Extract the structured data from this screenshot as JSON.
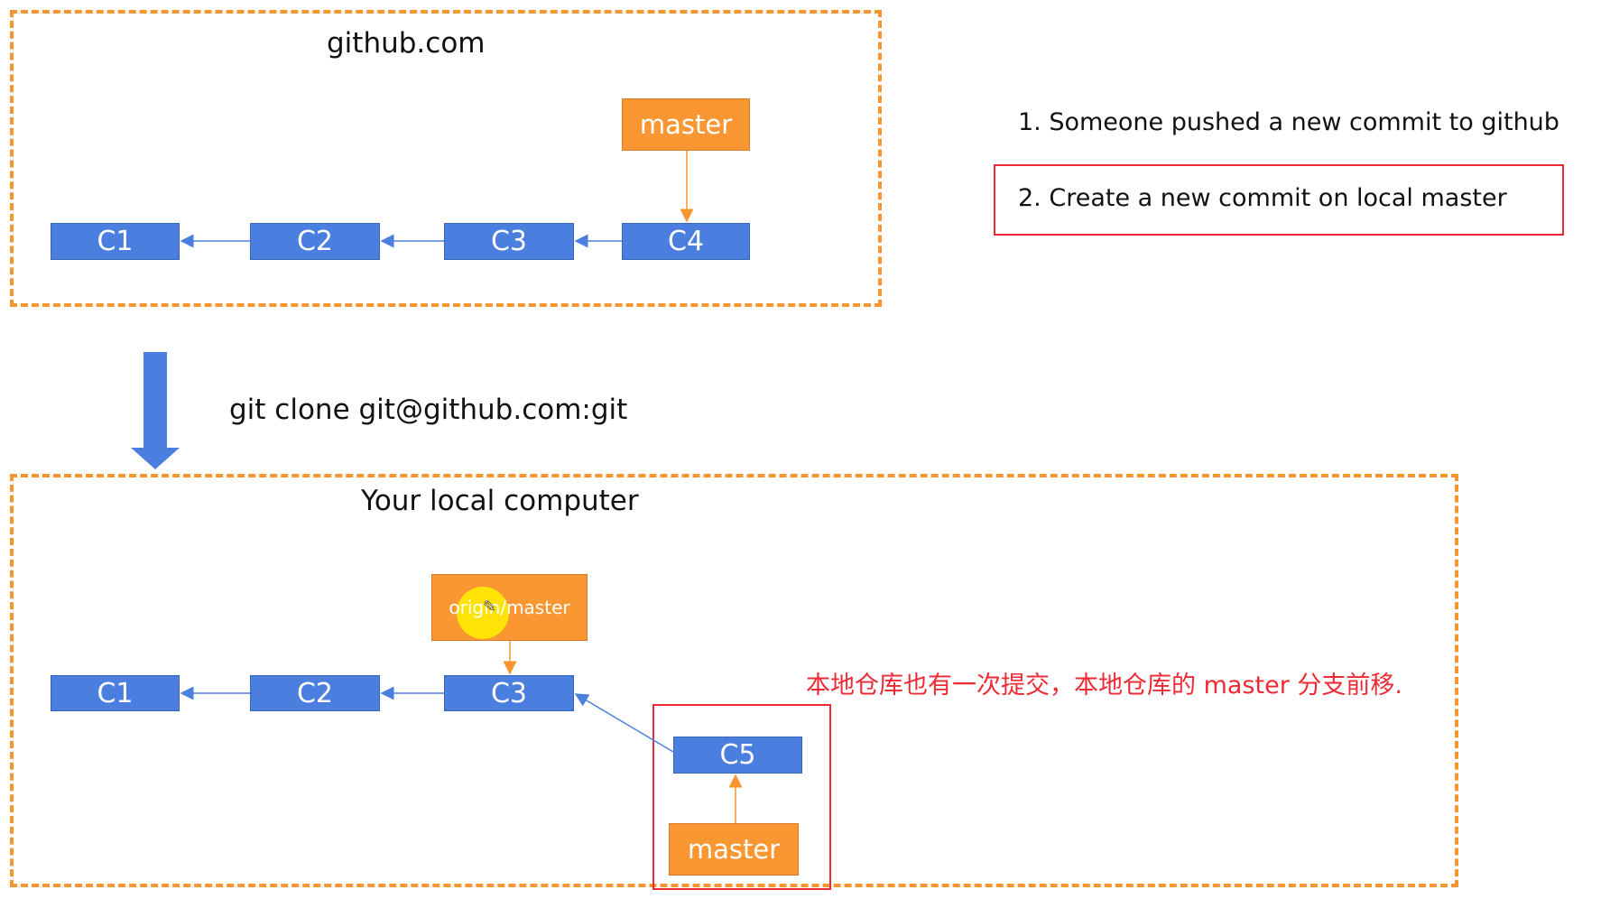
{
  "remote": {
    "title": "github.com",
    "branch_label": "master",
    "commits": [
      "C1",
      "C2",
      "C3",
      "C4"
    ]
  },
  "notes": {
    "step1": "1. Someone pushed a new commit to github",
    "step2": "2.  Create a new commit on local master"
  },
  "clone": {
    "command": "git clone git@github.com:git"
  },
  "local": {
    "title": "Your local computer",
    "remote_branch_label": "origin/master",
    "commits": [
      "C1",
      "C2",
      "C3"
    ],
    "new_commit": "C5",
    "branch_label": "master",
    "annotation": "本地仓库也有一次提交，本地仓库的 master 分支前移."
  },
  "colors": {
    "commit_blue": "#4a7fdf",
    "branch_orange": "#fb9733",
    "dashed_border": "#f7962f",
    "highlight_red": "#ee2a34"
  }
}
